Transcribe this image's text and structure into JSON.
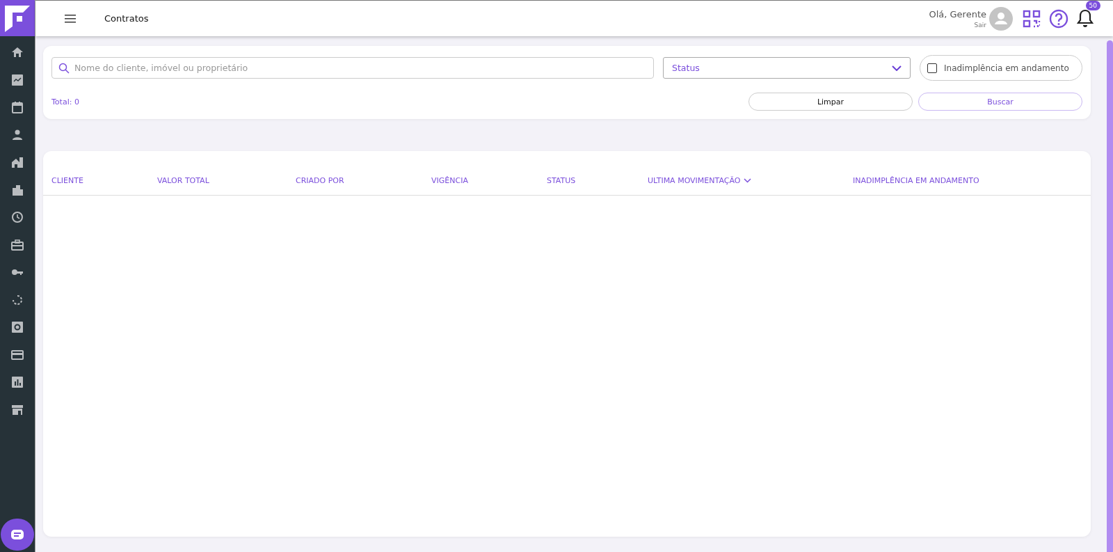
{
  "header": {
    "title": "Contratos",
    "greeting": "Olá, Gerente",
    "logout": "Sair",
    "notification_count": "50"
  },
  "filters": {
    "search": {
      "placeholder": "Nome do cliente, imóvel ou proprietário"
    },
    "status": {
      "placeholder": "Status"
    },
    "overdue": {
      "label": "Inadimplência em andamento",
      "checked": false
    },
    "total": "Total: 0",
    "buttons": [
      {
        "label": "Limpar",
        "kind": "secondary"
      },
      {
        "label": "Buscar",
        "kind": "primary"
      }
    ]
  },
  "table": {
    "columns": [
      {
        "label": "CLIENTE",
        "sorted": false
      },
      {
        "label": "VALOR TOTAL",
        "sorted": false
      },
      {
        "label": "CRIADO POR",
        "sorted": false
      },
      {
        "label": "VIGÊNCIA",
        "sorted": false
      },
      {
        "label": "STATUS",
        "sorted": false
      },
      {
        "label": "ULTIMA MOVIMENTAÇÃO",
        "sorted": true
      },
      {
        "label": "INADIMPLÊNCIA EM ANDAMENTO",
        "sorted": false
      }
    ]
  }
}
